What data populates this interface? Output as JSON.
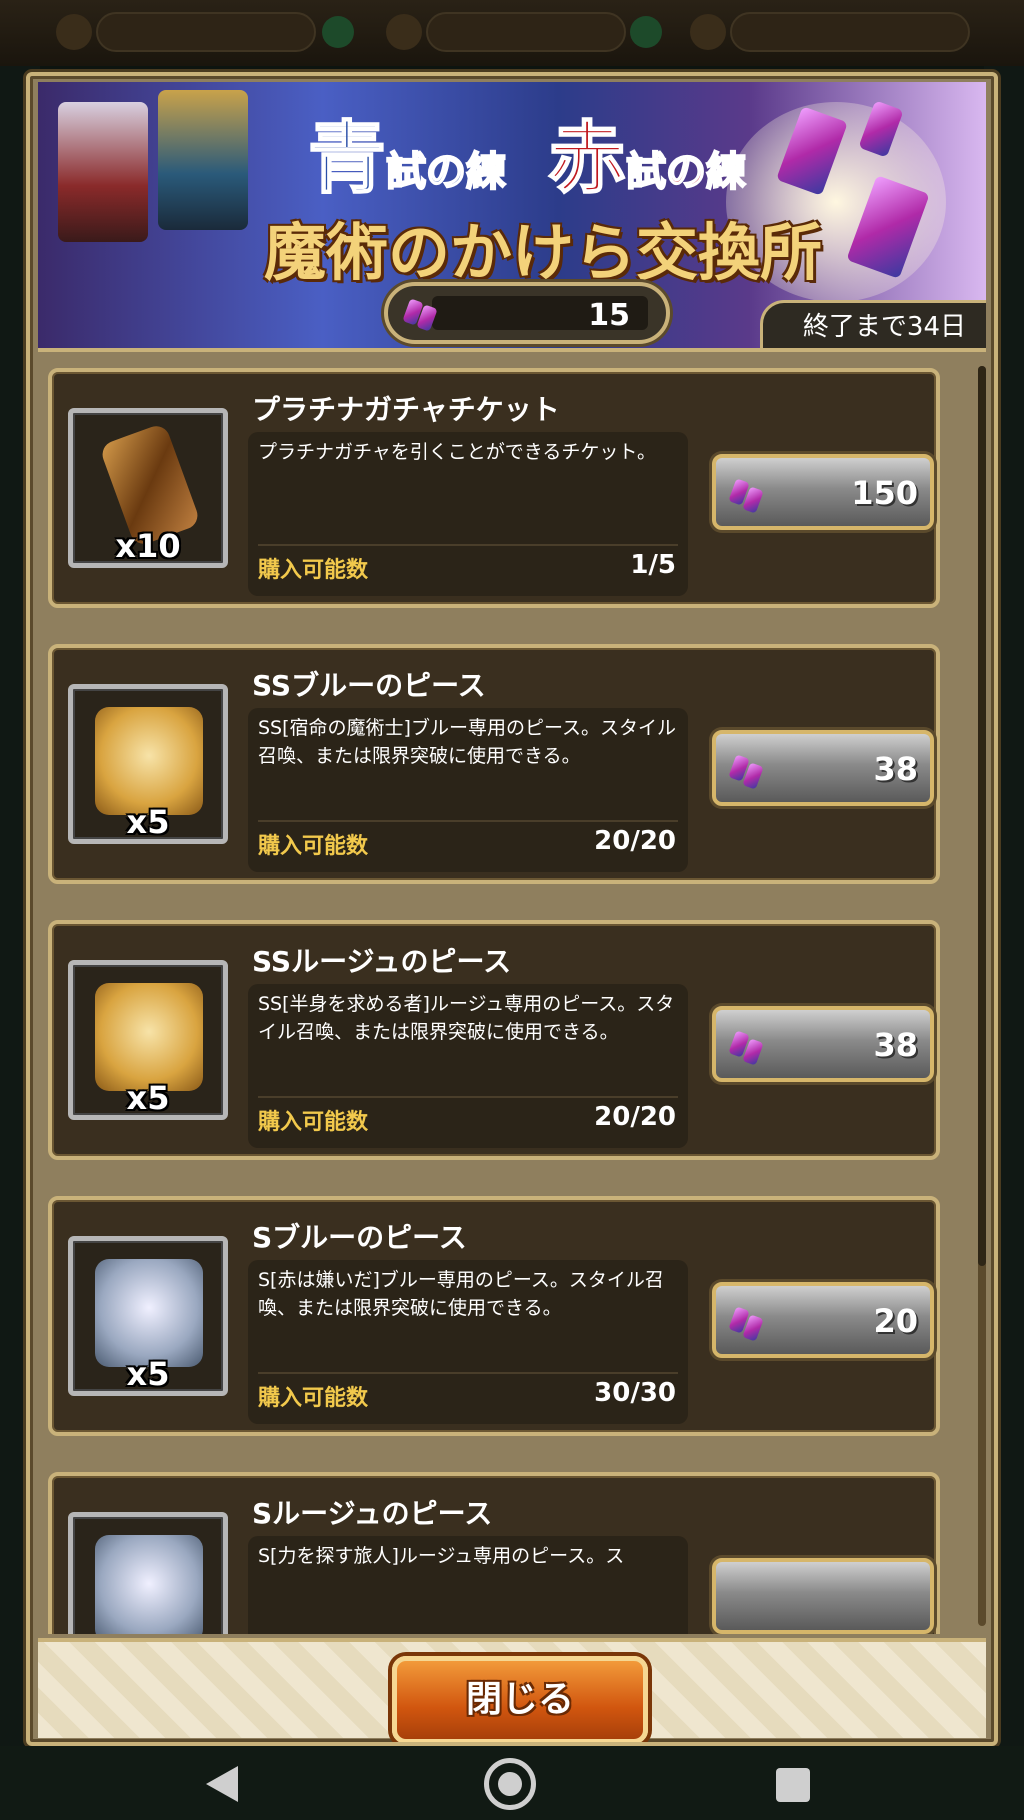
{
  "banner": {
    "title_blue_main": "青",
    "title_blue_sub": "試の練",
    "title_red_main": "赤",
    "title_red_sub": "試の練",
    "title_main": "魔術のかけら交換所",
    "end_label": "終了まで34日"
  },
  "currency": {
    "icon": "magic-fragment-icon",
    "value": "15"
  },
  "items": [
    {
      "name": "プラチナガチャチケット",
      "icon": "platinum-ticket-icon",
      "quantity": "x10",
      "description": "プラチナガチャを引くことができるチケット。",
      "buy_label": "購入可能数",
      "buy_count": "1/5",
      "price": "150"
    },
    {
      "name": "SSブルーのピース",
      "icon": "ss-blue-piece-icon",
      "quantity": "x5",
      "description": "SS[宿命の魔術士]ブルー専用のピース。スタイル召喚、または限界突破に使用できる。",
      "buy_label": "購入可能数",
      "buy_count": "20/20",
      "price": "38"
    },
    {
      "name": "SSルージュのピース",
      "icon": "ss-rouge-piece-icon",
      "quantity": "x5",
      "description": "SS[半身を求める者]ルージュ専用のピース。スタイル召喚、または限界突破に使用できる。",
      "buy_label": "購入可能数",
      "buy_count": "20/20",
      "price": "38"
    },
    {
      "name": "Sブルーのピース",
      "icon": "s-blue-piece-icon",
      "quantity": "x5",
      "description": "S[赤は嫌いだ]ブルー専用のピース。スタイル召喚、または限界突破に使用できる。",
      "buy_label": "購入可能数",
      "buy_count": "30/30",
      "price": "20"
    },
    {
      "name": "Sルージュのピース",
      "icon": "s-rouge-piece-icon",
      "quantity": "",
      "description": "S[力を探す旅人]ルージュ専用のピース。ス",
      "buy_label": "",
      "buy_count": "",
      "price": ""
    }
  ],
  "footer": {
    "close_label": "閉じる"
  },
  "colors": {
    "frame_gold": "#c9b27a",
    "buy_label_yellow": "#f2c94c",
    "close_button_orange": "#d1560f"
  }
}
